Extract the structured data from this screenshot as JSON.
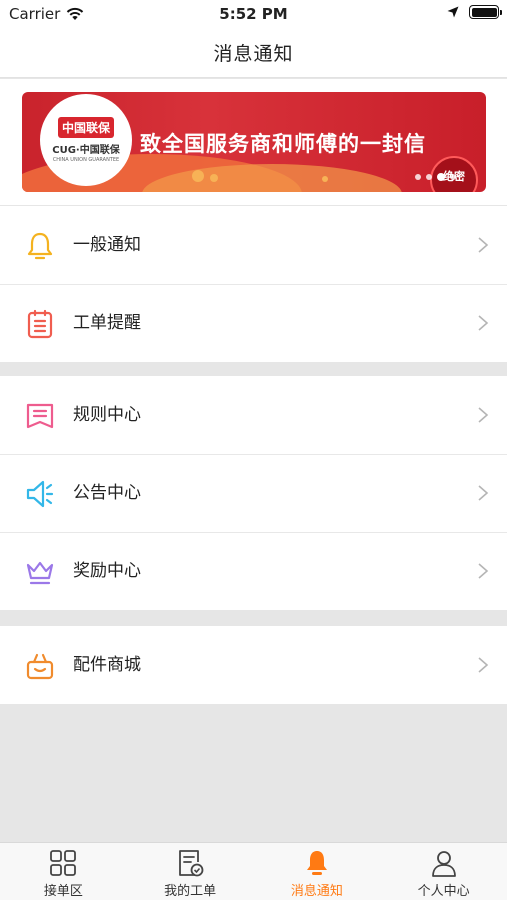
{
  "status": {
    "carrier": "Carrier",
    "time": "5:52 PM"
  },
  "nav": {
    "title": "消息通知"
  },
  "banner": {
    "logo_badge": "中国联保",
    "logo_name": "CUG·中国联保",
    "logo_sub": "CHINA UNION GUARANTEE",
    "headline": "致全国服务商和师傅的一封信",
    "stamp": "绝密"
  },
  "groups": [
    {
      "items": [
        {
          "label": "一般通知",
          "icon": "bell-icon",
          "color": "#f4b21f"
        },
        {
          "label": "工单提醒",
          "icon": "clipboard-icon",
          "color": "#f05d4f"
        }
      ]
    },
    {
      "items": [
        {
          "label": "规则中心",
          "icon": "rules-bookmark-icon",
          "color": "#ee5c8e"
        },
        {
          "label": "公告中心",
          "icon": "speaker-icon",
          "color": "#33b7e8"
        },
        {
          "label": "奖励中心",
          "icon": "crown-icon",
          "color": "#9b78e8"
        }
      ]
    },
    {
      "items": [
        {
          "label": "配件商城",
          "icon": "shopping-basket-icon",
          "color": "#f08b2d"
        }
      ]
    }
  ],
  "tabs": [
    {
      "label": "接单区",
      "icon": "grid-icon",
      "active": false
    },
    {
      "label": "我的工单",
      "icon": "order-check-icon",
      "active": false
    },
    {
      "label": "消息通知",
      "icon": "bell-icon",
      "active": true
    },
    {
      "label": "个人中心",
      "icon": "person-icon",
      "active": false
    }
  ],
  "colors": {
    "accent": "#ff7a13",
    "banner_red": "#c9232c",
    "background": "#e6e6e6"
  }
}
